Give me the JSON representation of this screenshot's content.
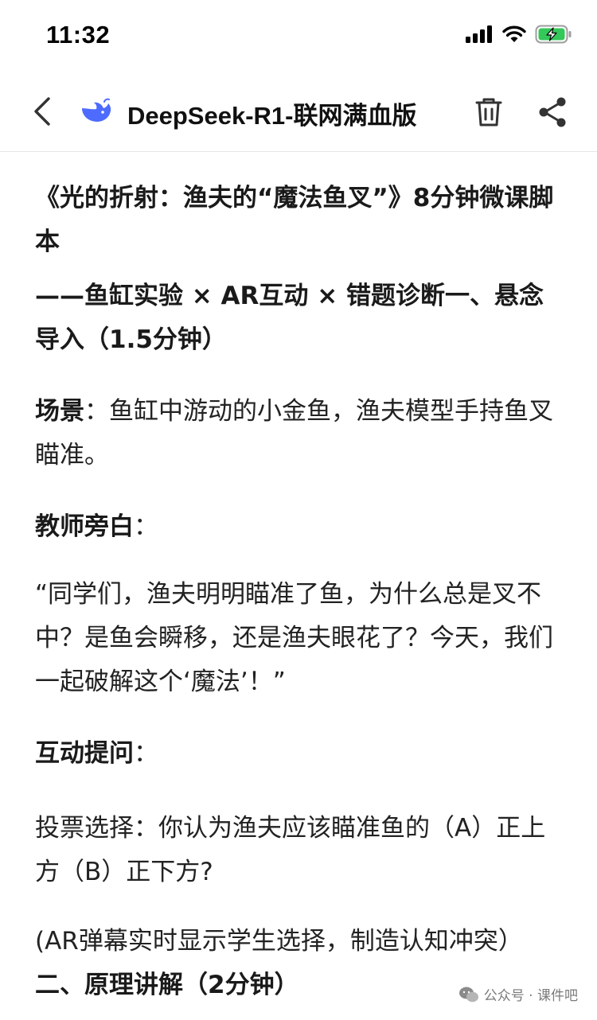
{
  "status_bar": {
    "time": "11:32"
  },
  "nav": {
    "title": "DeepSeek-R1-联网满血版",
    "logo_color": "#4D6BFE"
  },
  "content": {
    "title": "《光的折射：渔夫的“魔法鱼叉”》8分钟微课脚本",
    "subtitle": "——鱼缸实验 × AR互动 × 错题诊断一、悬念导入（1.5分钟）",
    "scene_label": "场景",
    "scene_text": "：鱼缸中游动的小金鱼，渔夫模型手持鱼叉瞄准。",
    "narration_label": "教师旁白",
    "narration_colon": "：",
    "quote": "“同学们，渔夫明明瞄准了鱼，为什么总是叉不中？是鱼会瞬移，还是渔夫眼花了？今天，我们一起破解这个‘魔法’！”",
    "interaction_label": "互动提问",
    "interaction_colon": "：",
    "vote_text": "投票选择：你认为渔夫应该瞄准鱼的（A）正上方（B）正下方?",
    "ar_text": "(AR弹幕实时显示学生选择，制造认知冲突）",
    "section2_heading": "二、原理讲解（2分钟）"
  },
  "watermark": {
    "text": "公众号 · 课件吧"
  }
}
